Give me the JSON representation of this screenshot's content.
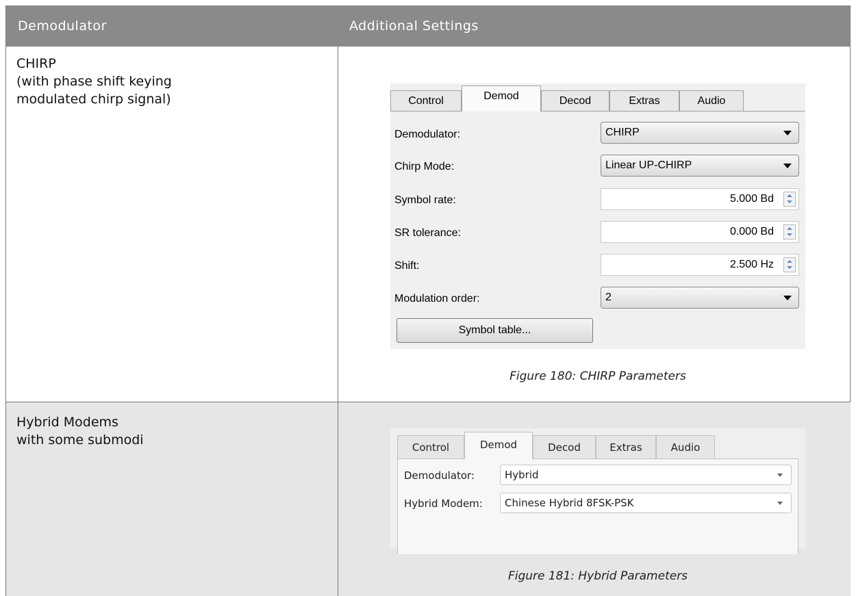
{
  "table": {
    "headers": [
      "Demodulator",
      "Additional Settings"
    ],
    "rows": [
      {
        "demodulator_lines": [
          "CHIRP",
          "(with phase shift keying",
          "modulated chirp signal)"
        ],
        "caption": "Figure 180: CHIRP Parameters"
      },
      {
        "demodulator_lines": [
          "Hybrid Modems",
          "with some submodi"
        ],
        "caption": "Figure 181: Hybrid Parameters"
      }
    ]
  },
  "chirp_panel": {
    "tabs": [
      "Control",
      "Demod",
      "Decod",
      "Extras",
      "Audio"
    ],
    "active_tab": "Demod",
    "fields": {
      "demodulator_label": "Demodulator:",
      "demodulator_value": "CHIRP",
      "chirp_mode_label": "Chirp Mode:",
      "chirp_mode_value": "Linear UP-CHIRP",
      "symbol_rate_label": "Symbol rate:",
      "symbol_rate_value": "5.000 Bd",
      "sr_tolerance_label": "SR tolerance:",
      "sr_tolerance_value": "0.000 Bd",
      "shift_label": "Shift:",
      "shift_value": "2.500 Hz",
      "modulation_order_label": "Modulation order:",
      "modulation_order_value": "2"
    },
    "symbol_table_button": "Symbol table..."
  },
  "hybrid_panel": {
    "tabs": [
      "Control",
      "Demod",
      "Decod",
      "Extras",
      "Audio"
    ],
    "active_tab": "Demod",
    "fields": {
      "demodulator_label": "Demodulator:",
      "demodulator_value": "Hybrid",
      "hybrid_modem_label": "Hybrid Modem:",
      "hybrid_modem_value": "Chinese Hybrid 8FSK-PSK"
    }
  },
  "colors": {
    "header_bg": "#8a8a8a",
    "header_text": "#ffffff",
    "row_shade": "#e6e6e6"
  }
}
